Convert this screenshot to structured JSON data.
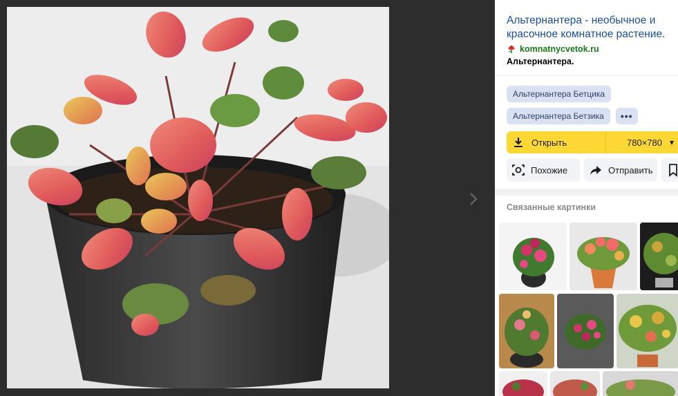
{
  "viewer": {
    "image_alt": "Альтернантера",
    "next_icon": "chevron-right-icon"
  },
  "panel": {
    "title": "Альтернантера - необычное и красочное комнатное растение.",
    "source_domain": "komnatnycvetok.ru",
    "source_icon": "flower-favicon-icon",
    "subtitle": "Альтернантера.",
    "tags": [
      "Альтернантера Бетцика",
      "Альтернантера Бетзика"
    ],
    "more_label": "•••",
    "open": {
      "label": "Открыть",
      "size": "780×780",
      "icon": "download-icon"
    },
    "actions": {
      "similar": "Похожие",
      "share": "Отправить"
    },
    "related_title": "Связанные картинки"
  },
  "colors": {
    "accent_yellow": "#fdd835",
    "link_blue": "#1a4fa0",
    "domain_green": "#1a7a1a",
    "tag_bg": "#d9e1f2"
  }
}
